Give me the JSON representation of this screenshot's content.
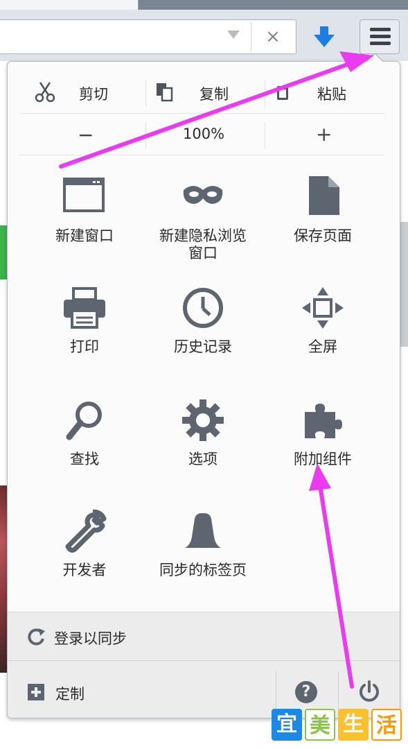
{
  "toolbar": {
    "url_clear_glyph": "×",
    "download_icon": "download-arrow-icon",
    "menu_icon": "hamburger-menu-icon"
  },
  "menu": {
    "edit": {
      "cut": "剪切",
      "copy": "复制",
      "paste": "粘贴"
    },
    "zoom": {
      "out": "−",
      "level": "100%",
      "in": "+"
    },
    "items": [
      {
        "label": "新建窗口",
        "icon": "new-window-icon"
      },
      {
        "label_line1": "新建隐私浏览",
        "label_line2": "窗口",
        "icon": "private-mask-icon"
      },
      {
        "label": "保存页面",
        "icon": "save-page-icon"
      },
      {
        "label": "打印",
        "icon": "printer-icon"
      },
      {
        "label": "历史记录",
        "icon": "history-clock-icon"
      },
      {
        "label": "全屏",
        "icon": "fullscreen-arrows-icon"
      },
      {
        "label": "查找",
        "icon": "magnifier-icon"
      },
      {
        "label": "选项",
        "icon": "gear-icon"
      },
      {
        "label": "附加组件",
        "icon": "puzzle-piece-icon"
      },
      {
        "label": "开发者",
        "icon": "wrench-icon"
      },
      {
        "label": "同步的标签页",
        "icon": "synced-tabs-icon"
      }
    ],
    "footer": {
      "sync_label": "登录以同步",
      "customize_label": "定制",
      "help_glyph": "?"
    }
  },
  "watermark": {
    "chars": [
      "宜",
      "美",
      "生",
      "活"
    ],
    "colors": [
      "#1e88e5",
      "#8bc34a",
      "#fbc02d",
      "#ff9800"
    ]
  },
  "colors": {
    "icon": "#5d6670",
    "annotation_arrow": "#e93bf0",
    "download_arrow": "#1a7fe0"
  }
}
